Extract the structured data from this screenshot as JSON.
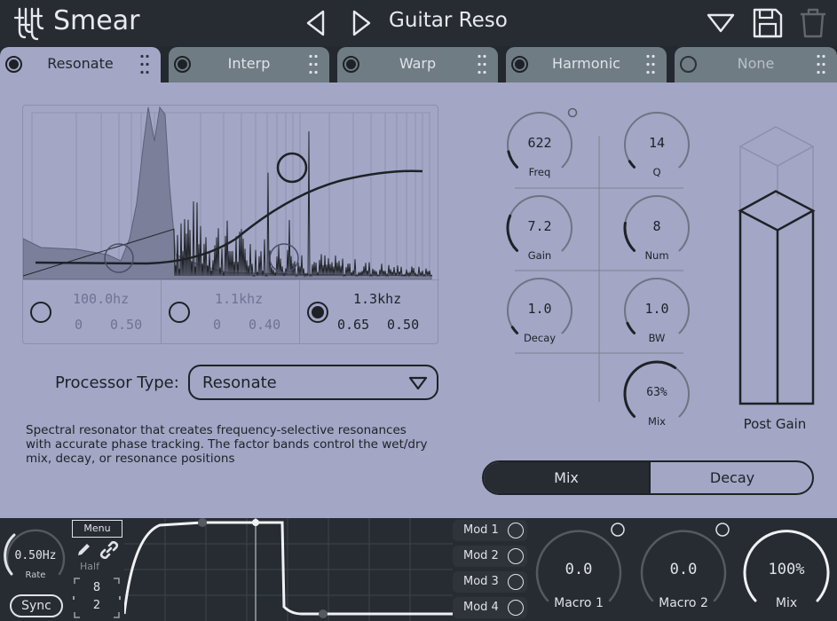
{
  "header": {
    "app_title": "Smear",
    "preset_name": "Guitar Reso"
  },
  "tabs": [
    {
      "label": "Resonate",
      "active": true,
      "enabled": true
    },
    {
      "label": "Interp",
      "active": false,
      "enabled": true
    },
    {
      "label": "Warp",
      "active": false,
      "enabled": true
    },
    {
      "label": "Harmonic",
      "active": false,
      "enabled": true
    },
    {
      "label": "None",
      "active": false,
      "enabled": false
    }
  ],
  "bands": [
    {
      "freq": "100.0hz",
      "v1": "0",
      "v2": "0.50",
      "active": false
    },
    {
      "freq": "1.1khz",
      "v1": "0",
      "v2": "0.40",
      "active": false
    },
    {
      "freq": "1.3khz",
      "v1": "0.65",
      "v2": "0.50",
      "active": true
    }
  ],
  "processor": {
    "label": "Processor Type:",
    "value": "Resonate",
    "description": "Spectral resonator that creates frequency-selective resonances with accurate phase tracking. The factor bands control the wet/dry mix, decay, or resonance positions"
  },
  "knobs": {
    "freq": {
      "value": "622",
      "label": "Freq",
      "level": 0.12
    },
    "q": {
      "value": "14",
      "label": "Q",
      "level": 0.05
    },
    "gain": {
      "value": "7.2",
      "label": "Gain",
      "level": 0.25
    },
    "num": {
      "value": "8",
      "label": "Num",
      "level": 0.2
    },
    "decay": {
      "value": "1.0",
      "label": "Decay",
      "level": 0.05
    },
    "bw": {
      "value": "1.0",
      "label": "BW",
      "level": 0.08
    },
    "mix": {
      "value": "63%",
      "label": "Mix",
      "level": 0.63
    }
  },
  "post_gain": {
    "label": "Post Gain",
    "level": 0.75
  },
  "segment": {
    "mix": "Mix",
    "decay": "Decay",
    "selected": "Mix"
  },
  "lfo": {
    "rate_value": "0.50Hz",
    "rate_label": "Rate",
    "sync_label": "Sync",
    "menu_label": "Menu",
    "half_label": "Half",
    "numerator": "8",
    "denominator": "2"
  },
  "mods": [
    "Mod 1",
    "Mod 2",
    "Mod 3",
    "Mod 4"
  ],
  "macros": [
    {
      "value": "0.0",
      "label": "Macro 1"
    },
    {
      "value": "0.0",
      "label": "Macro 2"
    },
    {
      "value": "100%",
      "label": "Mix"
    }
  ],
  "colors": {
    "panel": "#a3a6c5",
    "dark": "#272c33",
    "ink": "#1e2226"
  }
}
